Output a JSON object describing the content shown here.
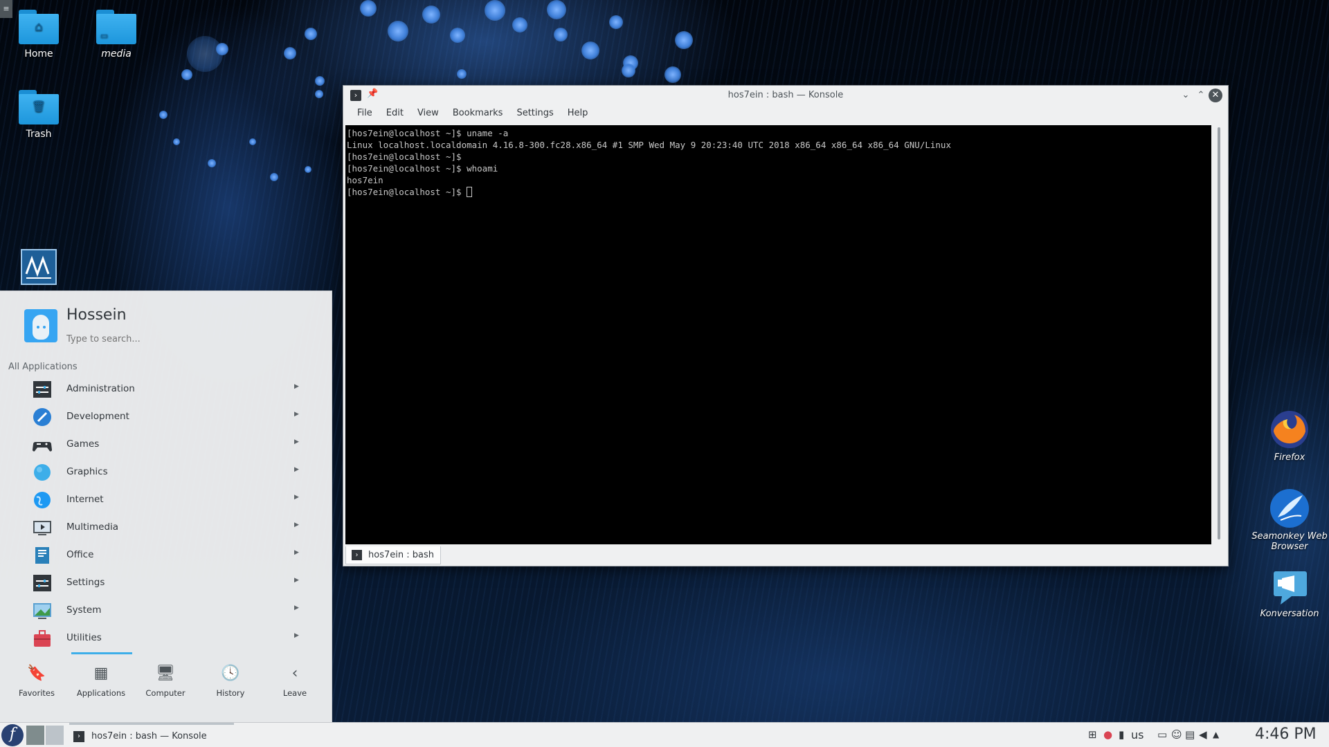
{
  "desktop": {
    "icons": [
      {
        "label": "Home",
        "symbol": "⌂"
      },
      {
        "label": "media",
        "symbol": "▭"
      },
      {
        "label": "Trash",
        "symbol": "🗑"
      }
    ],
    "right_icons": [
      {
        "label": "Firefox"
      },
      {
        "label": "Seamonkey Web Browser"
      },
      {
        "label": "Konversation"
      }
    ]
  },
  "konsole": {
    "title": "hos7ein : bash — Konsole",
    "menu": [
      "File",
      "Edit",
      "View",
      "Bookmarks",
      "Settings",
      "Help"
    ],
    "terminal_lines": [
      "[hos7ein@localhost ~]$ uname -a",
      "Linux localhost.localdomain 4.16.8-300.fc28.x86_64 #1 SMP Wed May 9 20:23:40 UTC 2018 x86_64 x86_64 x86_64 GNU/Linux",
      "[hos7ein@localhost ~]$",
      "[hos7ein@localhost ~]$ whoami",
      "hos7ein",
      "[hos7ein@localhost ~]$ "
    ],
    "tab_label": "hos7ein : bash"
  },
  "launcher": {
    "user": "Hossein",
    "search_placeholder": "Type to search...",
    "section_title": "All Applications",
    "categories": [
      {
        "label": "Administration",
        "icon": "administration-icon",
        "color": "#31363b"
      },
      {
        "label": "Development",
        "icon": "development-icon",
        "color": "#2a7fd4"
      },
      {
        "label": "Games",
        "icon": "gamepad-icon",
        "color": "#31363b"
      },
      {
        "label": "Graphics",
        "icon": "graphics-icon",
        "color": "#3daee9"
      },
      {
        "label": "Internet",
        "icon": "internet-icon",
        "color": "#1d99f3"
      },
      {
        "label": "Multimedia",
        "icon": "multimedia-icon",
        "color": "#4d5459"
      },
      {
        "label": "Office",
        "icon": "office-icon",
        "color": "#2980b9"
      },
      {
        "label": "Settings",
        "icon": "settings-icon",
        "color": "#31363b"
      },
      {
        "label": "System",
        "icon": "system-icon",
        "color": "#5aa0d0"
      },
      {
        "label": "Utilities",
        "icon": "utilities-icon",
        "color": "#da4453"
      }
    ],
    "tabs": [
      {
        "label": "Favorites",
        "glyph": "🔖"
      },
      {
        "label": "Applications",
        "glyph": "▦"
      },
      {
        "label": "Computer",
        "glyph": "🖥"
      },
      {
        "label": "History",
        "glyph": "🕓"
      },
      {
        "label": "Leave",
        "glyph": "‹"
      }
    ],
    "active_tab": "Applications"
  },
  "taskbar": {
    "start_glyph": "f",
    "task_label": "hos7ein : bash — Konsole",
    "keyboard_layout": "us",
    "clock": "4:46 PM"
  },
  "colors": {
    "accent": "#3daee9",
    "panel": "#eff0f1",
    "terminal_bg": "#000000",
    "terminal_fg": "#c8c8c8"
  }
}
